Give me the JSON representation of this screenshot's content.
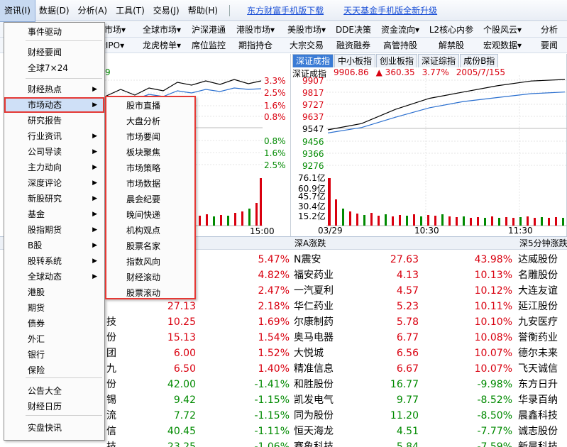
{
  "menubar": {
    "items": [
      "资讯(I)",
      "数据(D)",
      "分析(A)",
      "工具(T)",
      "交易(J)",
      "帮助(H)"
    ],
    "links": [
      "东方财富手机版下载",
      "天天基金手机版全新升级"
    ]
  },
  "toolbar": {
    "row1": [
      "",
      "",
      "权市场▾",
      "全球市场▾",
      "沪深港通",
      "港股市场▾",
      "美股市场▾",
      "DDE决策",
      "资金流向▾",
      "L2核心内参",
      "个股风云▾",
      "分析"
    ],
    "row2": [
      "",
      "",
      "股IPO▾",
      "龙虎榜单▾",
      "席位监控",
      "期指持仓",
      "大宗交易",
      "融资融券",
      "高管持股",
      "解禁股",
      "宏观数据▾",
      "要闻"
    ]
  },
  "left_chart": {
    "pct_labels_up": [
      "3.3%",
      "2.5%",
      "1.6%",
      "0.8%"
    ],
    "pct_labels_down": [
      "0.8%",
      "1.6%",
      "2.5%"
    ],
    "header_fragment": "9",
    "time_end": "15:00"
  },
  "right_chart": {
    "tabs": [
      "深证成指",
      "中小板指",
      "创业板指",
      "深证综指",
      "成份B指"
    ],
    "name": "深证成指",
    "price": "9906.86",
    "change": "▲ 360.35",
    "change_pct": "3.77%",
    "ratio": "2005/7/155",
    "price_ticks": [
      "9907",
      "9817",
      "9727",
      "9637",
      "9547",
      "9456",
      "9366",
      "9276"
    ],
    "vol_ticks": [
      "76.1亿",
      "60.9亿",
      "45.7亿",
      "30.4亿",
      "15.2亿"
    ],
    "times": [
      "03/29",
      "10:30",
      "11:30"
    ]
  },
  "chart_data": [
    {
      "type": "line",
      "title": "深证成指",
      "ylim": [
        9276,
        9907
      ],
      "x": [
        "03/29",
        "10:30",
        "11:30"
      ],
      "series": [
        {
          "name": "深证成指",
          "values": [
            9560,
            9600,
            9690,
            9760,
            9800,
            9840,
            9870,
            9880
          ]
        },
        {
          "values": [
            9540,
            9575,
            9640,
            9700,
            9740,
            9765,
            9790,
            9800
          ]
        }
      ]
    }
  ],
  "sections": {
    "mid": "深A涨跌",
    "right": "深5分钟涨跌"
  },
  "table": {
    "rows": [
      {
        "c1": "",
        "c2": "",
        "c3": "5.47%",
        "n1": "N震安",
        "p1": "27.63",
        "g1": "43.98%",
        "n2": "达威股份"
      },
      {
        "c1": "",
        "c2": "",
        "c3": "4.82%",
        "n1": "福安药业",
        "p1": "4.13",
        "g1": "10.13%",
        "n2": "名雕股份"
      },
      {
        "c1": "",
        "c2": "",
        "c3": "2.47%",
        "n1": "一汽夏利",
        "p1": "4.57",
        "g1": "10.12%",
        "n2": "大连友谊"
      },
      {
        "c1": "",
        "c2": "27.13",
        "c3": "2.18%",
        "n1": "华仁药业",
        "p1": "5.23",
        "g1": "10.11%",
        "n2": "延江股份"
      },
      {
        "c1": "技",
        "c2": "10.25",
        "c3": "1.69%",
        "n1": "尔康制药",
        "p1": "5.78",
        "g1": "10.10%",
        "n2": "九安医疗"
      },
      {
        "c1": "份",
        "c2": "15.13",
        "c3": "1.54%",
        "n1": "奥马电器",
        "p1": "6.77",
        "g1": "10.08%",
        "n2": "誉衡药业"
      },
      {
        "c1": "团",
        "c2": "6.00",
        "c3": "1.52%",
        "n1": "大悦城",
        "p1": "6.56",
        "g1": "10.07%",
        "n2": "德尔未来"
      },
      {
        "c1": "九",
        "c2": "6.50",
        "c3": "1.40%",
        "n1": "精准信息",
        "p1": "6.67",
        "g1": "10.07%",
        "n2": "飞天诚信"
      },
      {
        "c1": "份",
        "c2": "42.00",
        "c3": "-1.41%",
        "n1": "和胜股份",
        "p1": "16.77",
        "g1": "-9.98%",
        "n2": "东方日升"
      },
      {
        "c1": "锡",
        "c2": "9.42",
        "c3": "-1.15%",
        "n1": "凯发电气",
        "p1": "9.77",
        "g1": "-8.52%",
        "n2": "华录百纳"
      },
      {
        "c1": "流",
        "c2": "7.72",
        "c3": "-1.15%",
        "n1": "同为股份",
        "p1": "11.20",
        "g1": "-8.50%",
        "n2": "晨鑫科技"
      },
      {
        "c1": "信",
        "c2": "40.45",
        "c3": "-1.11%",
        "n1": "恒天海龙",
        "p1": "4.51",
        "g1": "-7.77%",
        "n2": "诚志股份"
      },
      {
        "c1": "技",
        "c2": "23.25",
        "c3": "-1.06%",
        "n1": "赛象科技",
        "p1": "5.84",
        "g1": "-7.59%",
        "n2": "新晨科技"
      }
    ]
  },
  "dropdown": {
    "items": [
      {
        "label": "事件驱动",
        "arrow": ""
      },
      {
        "label": "财经要闻",
        "arrow": ""
      },
      {
        "label": "全球7×24",
        "arrow": ""
      },
      {
        "label": "财经热点",
        "arrow": "▶"
      },
      {
        "label": "市场动态",
        "arrow": "▶"
      },
      {
        "label": "研究报告",
        "arrow": ""
      },
      {
        "label": "行业资讯",
        "arrow": "▶"
      },
      {
        "label": "公司导读",
        "arrow": "▶"
      },
      {
        "label": "主力动向",
        "arrow": "▶"
      },
      {
        "label": "深度评论",
        "arrow": "▶"
      },
      {
        "label": "新股研究",
        "arrow": "▶"
      },
      {
        "label": "基金",
        "arrow": "▶"
      },
      {
        "label": "股指期货",
        "arrow": "▶"
      },
      {
        "label": "B股",
        "arrow": "▶"
      },
      {
        "label": "股转系统",
        "arrow": "▶"
      },
      {
        "label": "全球动态",
        "arrow": "▶"
      },
      {
        "label": "港股",
        "arrow": ""
      },
      {
        "label": "期货",
        "arrow": ""
      },
      {
        "label": "债券",
        "arrow": ""
      },
      {
        "label": "外汇",
        "arrow": ""
      },
      {
        "label": "银行",
        "arrow": ""
      },
      {
        "label": "保险",
        "arrow": ""
      },
      {
        "label": "公告大全",
        "arrow": ""
      },
      {
        "label": "财经日历",
        "arrow": ""
      },
      {
        "label": "实盘快讯",
        "arrow": ""
      }
    ]
  },
  "submenu": {
    "items": [
      "股市直播",
      "大盘分析",
      "市场要闻",
      "板块聚焦",
      "市场策略",
      "市场数据",
      "晨会纪要",
      "晚间快递",
      "机构观点",
      "股票名家",
      "指数风向",
      "财经滚动",
      "股票滚动"
    ]
  },
  "colors": {
    "up": "#d9000f",
    "down": "#008a00",
    "highlight": "#e53935"
  }
}
